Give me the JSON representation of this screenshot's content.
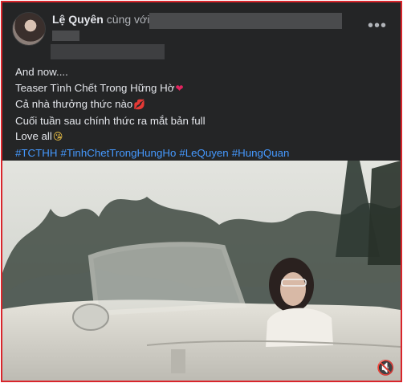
{
  "post": {
    "author": "Lệ Quyên",
    "with_label": "cùng với",
    "more_label": "•••",
    "lines": [
      "And now....",
      "Teaser Tình Chết Trong Hững Hờ",
      "Cả nhà thưởng thức nào",
      "Cuối tuần sau chính thức ra mắt bản full",
      "Love all"
    ],
    "emojis": [
      "heart-emoji",
      "lips-emoji",
      "kiss-face-emoji"
    ],
    "hashtags": [
      "#TCTHH",
      "#TinhChetTrongHungHo",
      "#LeQuyen",
      "#HungQuan"
    ]
  },
  "video": {
    "mute_icon": "speaker-muted-icon"
  },
  "colors": {
    "frame_border": "#d9252b",
    "background": "#242526",
    "text": "#e4e6eb",
    "hashtag": "#4599ff"
  }
}
